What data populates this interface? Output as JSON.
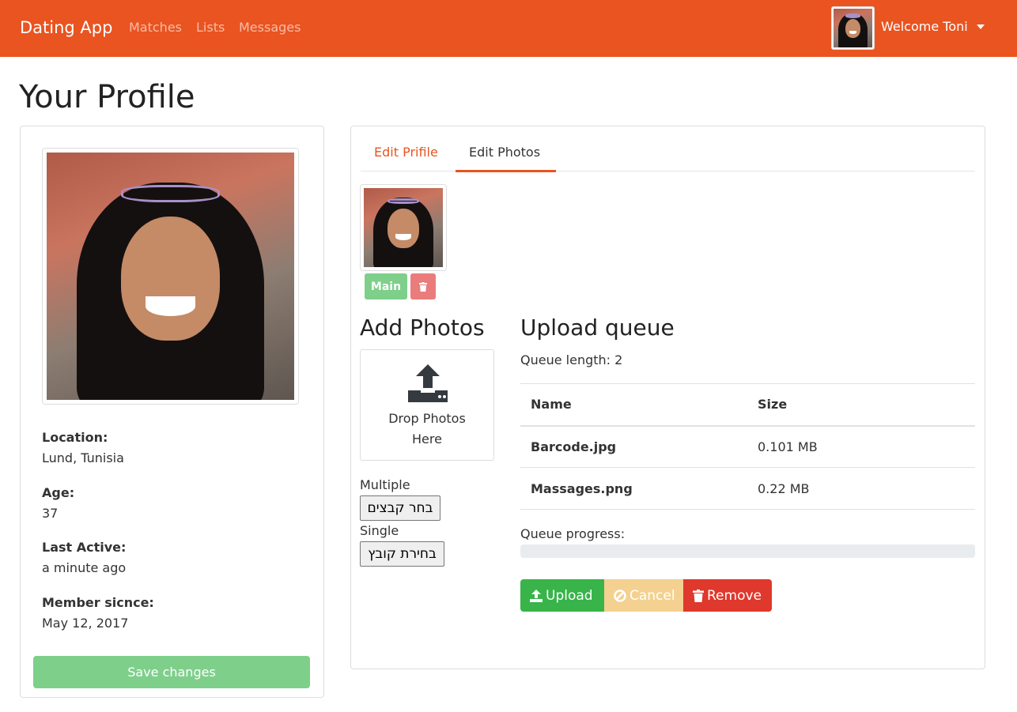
{
  "navbar": {
    "brand": "Dating App",
    "links": [
      "Matches",
      "Lists",
      "Messages"
    ],
    "welcome": "Welcome Toni"
  },
  "page": {
    "title": "Your Profile"
  },
  "profile_card": {
    "fields": [
      {
        "label": "Location:",
        "value": "Lund, Tunisia"
      },
      {
        "label": "Age:",
        "value": "37"
      },
      {
        "label": "Last Active:",
        "value": "a minute ago"
      },
      {
        "label": "Member sicnce:",
        "value": "May 12, 2017"
      }
    ],
    "save_label": "Save changes"
  },
  "tabs": [
    {
      "label": "Edit Prifile",
      "active": false
    },
    {
      "label": "Edit Photos",
      "active": true
    }
  ],
  "photos": {
    "main_label": "Main",
    "delete_icon": "trash-icon"
  },
  "add_photos": {
    "title": "Add Photos",
    "drop_text_line1": "Drop Photos",
    "drop_text_line2": "Here",
    "multiple_label": "Multiple",
    "multiple_button": "בחר קבצים",
    "single_label": "Single",
    "single_button": "בחירת קובץ"
  },
  "upload_queue": {
    "title": "Upload queue",
    "queue_length": "Queue length: 2",
    "columns": [
      "Name",
      "Size"
    ],
    "rows": [
      {
        "name": "Barcode.jpg",
        "size": "0.101 MB"
      },
      {
        "name": "Massages.png",
        "size": "0.22 MB"
      }
    ],
    "progress_label": "Queue progress:",
    "progress_value": 0,
    "buttons": {
      "upload": "Upload",
      "cancel": "Cancel",
      "remove": "Remove"
    }
  },
  "colors": {
    "primary": "#e95420",
    "success": "#38b44a",
    "warning": "#f4d190",
    "danger": "#df382c"
  }
}
